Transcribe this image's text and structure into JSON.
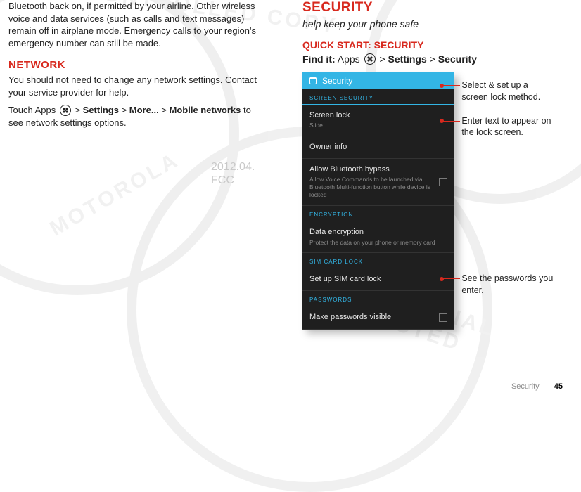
{
  "left": {
    "para1": "Bluetooth back on, if permitted by your airline. Other wireless voice and data services (such as calls and text messages) remain off in airplane mode. Emergency calls to your region's emergency number can still be made.",
    "network_head": "NETWORK",
    "para2": "You should not need to change any network settings. Contact your service provider for help.",
    "para3_pre": "Touch Apps ",
    "para3_mid1": " > ",
    "para3_b1": "Settings",
    "para3_mid2": " > ",
    "para3_b2": "More...",
    "para3_mid3": " > ",
    "para3_b3": "Mobile networks",
    "para3_post": " to see network settings options."
  },
  "right": {
    "security_head": "SECURITY",
    "sub": "help keep your phone safe",
    "quick": "QUICK START: SECURITY",
    "find_label": "Find it:",
    "find_pre": " Apps ",
    "find_mid1": " > ",
    "find_b1": "Settings",
    "find_mid2": " > ",
    "find_b2": "Security"
  },
  "phone": {
    "title": "Security",
    "sec1": "SCREEN SECURITY",
    "row1_t": "Screen lock",
    "row1_d": "Slide",
    "row2_t": "Owner info",
    "row3_t": "Allow Bluetooth bypass",
    "row3_d": "Allow Voice Commands to be launched via Bluetooth Multi-function button while device is locked",
    "sec2": "ENCRYPTION",
    "row4_t": "Data encryption",
    "row4_d": "Protect the data on your phone or memory card",
    "sec3": "SIM CARD LOCK",
    "row5_t": "Set up SIM card lock",
    "sec4": "PASSWORDS",
    "row6_t": "Make passwords visible"
  },
  "callouts": {
    "c1": "Select & set up a screen lock method.",
    "c2": "Enter text to appear on the lock screen.",
    "c3": "See the passwords you enter."
  },
  "ghost": {
    "l1": "2012.04.",
    "l2": "FCC"
  },
  "footer": {
    "label": "Security",
    "page": "45"
  }
}
